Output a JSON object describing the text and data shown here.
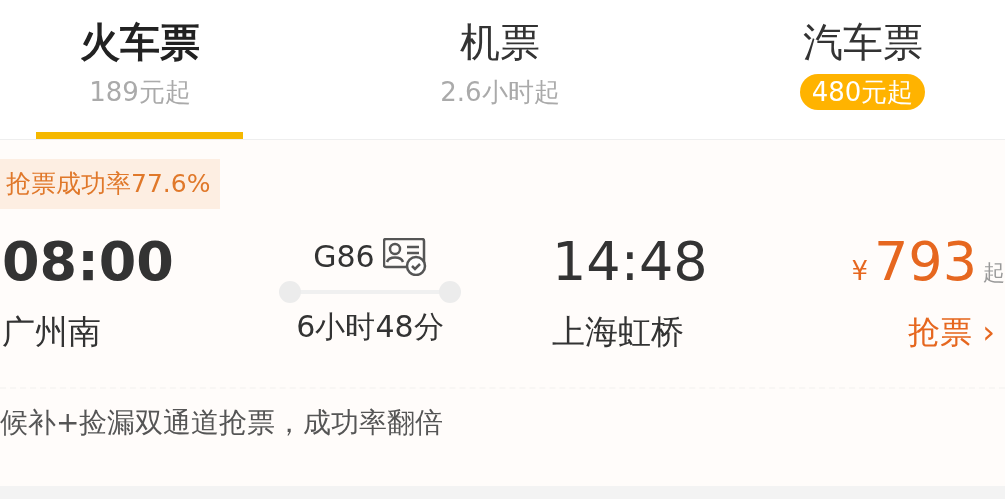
{
  "tabs": [
    {
      "label": "火车票",
      "sub": "189元起",
      "selected": true,
      "sub_highlight": false
    },
    {
      "label": "机票",
      "sub": "2.6小时起",
      "selected": false,
      "sub_highlight": false
    },
    {
      "label": "汽车票",
      "sub": "480元起",
      "selected": false,
      "sub_highlight": true
    }
  ],
  "train": {
    "success_rate": "抢票成功率77.6%",
    "depart_time": "08:00",
    "depart_station": "广州南",
    "train_no": "G86",
    "duration": "6小时48分",
    "arrive_time": "14:48",
    "arrive_station": "上海虹桥",
    "currency": "¥",
    "price": "793",
    "price_suffix": "起",
    "action": "抢票",
    "action_arrow": "›",
    "note": "候补+捡漏双通道抢票，成功率翻倍"
  }
}
